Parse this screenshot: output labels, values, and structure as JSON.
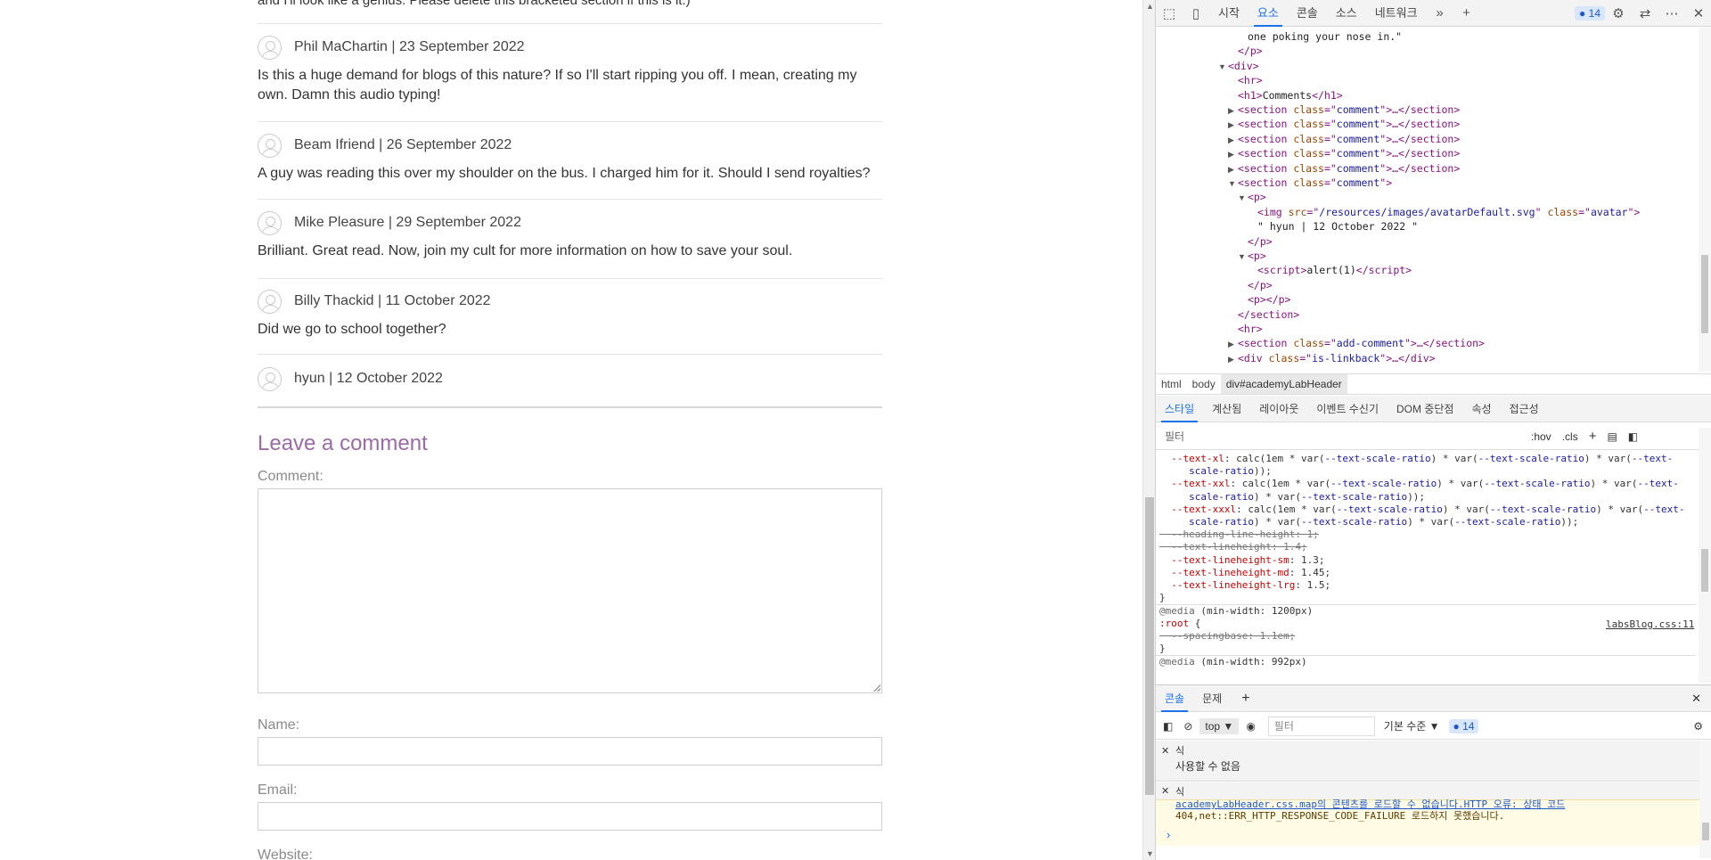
{
  "page": {
    "cut_text": "and I'll look like a genius. Please delete this bracketed section if this is it.)",
    "comments": [
      {
        "author": "Phil MaChartin | 23 September 2022",
        "body": "Is this a huge demand for blogs of this nature? If so I'll start ripping you off. I mean, creating my own. Damn this audio typing!"
      },
      {
        "author": "Beam Ifriend | 26 September 2022",
        "body": "A guy was reading this over my shoulder on the bus. I charged him for it. Should I send royalties?"
      },
      {
        "author": "Mike Pleasure | 29 September 2022",
        "body": "Brilliant. Great read. Now, join my cult for more information on how to save your soul."
      },
      {
        "author": "Billy Thackid | 11 October 2022",
        "body": "Did we go to school together?"
      },
      {
        "author": "hyun | 12 October 2022",
        "body": ""
      }
    ],
    "leave_heading": "Leave a comment",
    "comment_label": "Comment:",
    "name_label": "Name:",
    "email_label": "Email:",
    "website_label": "Website:"
  },
  "devtools": {
    "tabs": [
      "시작",
      "요소",
      "콘솔",
      "소스",
      "네트워크"
    ],
    "active_tab": "요소",
    "issue_count": "14",
    "dom_lines": [
      {
        "indent": 0,
        "html": "<span class='x'>one poking your nose in.\"</span>"
      },
      {
        "indent": -1,
        "html": "&lt;/p&gt;"
      },
      {
        "indent": -2,
        "tri": "▼",
        "html": "&lt;div&gt;"
      },
      {
        "indent": -1,
        "html": "&lt;hr&gt;"
      },
      {
        "indent": -1,
        "html": "&lt;h1&gt;<span class='x'>Comments</span>&lt;/h1&gt;"
      },
      {
        "indent": -1,
        "tri": "▶",
        "html": "&lt;section <span class='a'>class</span>=\"<span class='v'>comment</span>\"&gt;…&lt;/section&gt;"
      },
      {
        "indent": -1,
        "tri": "▶",
        "html": "&lt;section <span class='a'>class</span>=\"<span class='v'>comment</span>\"&gt;…&lt;/section&gt;"
      },
      {
        "indent": -1,
        "tri": "▶",
        "html": "&lt;section <span class='a'>class</span>=\"<span class='v'>comment</span>\"&gt;…&lt;/section&gt;"
      },
      {
        "indent": -1,
        "tri": "▶",
        "html": "&lt;section <span class='a'>class</span>=\"<span class='v'>comment</span>\"&gt;…&lt;/section&gt;"
      },
      {
        "indent": -1,
        "tri": "▶",
        "html": "&lt;section <span class='a'>class</span>=\"<span class='v'>comment</span>\"&gt;…&lt;/section&gt;"
      },
      {
        "indent": -1,
        "tri": "▼",
        "html": "&lt;section <span class='a'>class</span>=\"<span class='v'>comment</span>\"&gt;"
      },
      {
        "indent": 0,
        "tri": "▼",
        "html": "&lt;p&gt;"
      },
      {
        "indent": 1,
        "html": "&lt;img <span class='a'>src</span>=\"<span class='v'>/resources/images/avatarDefault.svg</span>\" <span class='a'>class</span>=\"<span class='v'>avatar</span>\"&gt;"
      },
      {
        "indent": 1,
        "html": "<span class='x'>\" hyun | 12 October 2022 \"</span>"
      },
      {
        "indent": 0,
        "html": "&lt;/p&gt;"
      },
      {
        "indent": 0,
        "tri": "▼",
        "html": "&lt;p&gt;"
      },
      {
        "indent": 1,
        "html": "&lt;script&gt;<span class='x'>alert(1)</span>&lt;/script&gt;"
      },
      {
        "indent": 0,
        "html": "&lt;/p&gt;"
      },
      {
        "indent": 0,
        "html": "&lt;p&gt;&lt;/p&gt;"
      },
      {
        "indent": -1,
        "html": "&lt;/section&gt;"
      },
      {
        "indent": -1,
        "html": "&lt;hr&gt;"
      },
      {
        "indent": -1,
        "tri": "▶",
        "html": "&lt;section <span class='a'>class</span>=\"<span class='v'>add-comment</span>\"&gt;…&lt;/section&gt;"
      },
      {
        "indent": -1,
        "tri": "▶",
        "html": "&lt;div <span class='a'>class</span>=\"<span class='v'>is-linkback</span>\"&gt;…&lt;/div&gt;"
      }
    ],
    "breadcrumbs": [
      "html",
      "body",
      "div#academyLabHeader"
    ],
    "style_tabs": [
      "스타일",
      "계산됨",
      "레이아웃",
      "이벤트 수신기",
      "DOM 중단점",
      "속성",
      "접근성"
    ],
    "filter_placeholder": "필터",
    "hov": ":hov",
    "cls": ".cls",
    "css_lines": [
      {
        "html": "  <span class='p'>--text-xl</span>: calc(1em * var(<span class='vr'>--text-scale-ratio</span>) * var(<span class='vr'>--text-scale-ratio</span>) * var(<span class='vr'>--text-</span>"
      },
      {
        "html": "     <span class='vr'>scale-ratio</span>));"
      },
      {
        "html": "  <span class='p'>--text-xxl</span>: calc(1em * var(<span class='vr'>--text-scale-ratio</span>) * var(<span class='vr'>--text-scale-ratio</span>) * var(<span class='vr'>--text-</span>"
      },
      {
        "html": "     <span class='vr'>scale-ratio</span>) * var(<span class='vr'>--text-scale-ratio</span>));"
      },
      {
        "html": "  <span class='p'>--text-xxxl</span>: calc(1em * var(<span class='vr'>--text-scale-ratio</span>) * var(<span class='vr'>--text-scale-ratio</span>) * var(<span class='vr'>--text-</span>"
      },
      {
        "html": "     <span class='vr'>scale-ratio</span>) * var(<span class='vr'>--text-scale-ratio</span>) * var(<span class='vr'>--text-scale-ratio</span>));"
      },
      {
        "html": "  --heading-line-height: 1;",
        "strike": true
      },
      {
        "html": "  --text-lineheight: 1.4;",
        "strike": true
      },
      {
        "html": "  <span class='p'>--text-lineheight-sm</span>: 1.3;"
      },
      {
        "html": "  <span class='p'>--text-lineheight-md</span>: 1.45;"
      },
      {
        "html": "  <span class='p'>--text-lineheight-lrg</span>: 1.5;"
      },
      {
        "html": "}"
      },
      {
        "html": "<span style='color:#666'>@media</span> (min-width: 1200px)",
        "rule": true
      },
      {
        "html": "<span class='p'>:root</span> {"
      },
      {
        "html": "  --spacingbase: 1.1em;",
        "strike": true
      },
      {
        "html": "}"
      },
      {
        "html": "<span style='color:#666'>@media</span> (min-width: 992px)",
        "rule": true
      }
    ],
    "css_link": "labsBlog.css:11",
    "drawer_tabs": [
      "콘솔",
      "문제"
    ],
    "console_context": "top",
    "console_filter": "필터",
    "console_level": "기본 수준",
    "live_expr_1_label": "식",
    "live_expr_1_value": "사용할 수 없음",
    "live_expr_2_label": "식",
    "error_text_1": "academyLabHeader.css.map의 콘텐츠를 로드할 수 없습니다.HTTP 오류: 상태 코드",
    "error_text_2": "404,net::ERR_HTTP_RESPONSE_CODE_FAILURE 로드하지 못했습니다."
  }
}
